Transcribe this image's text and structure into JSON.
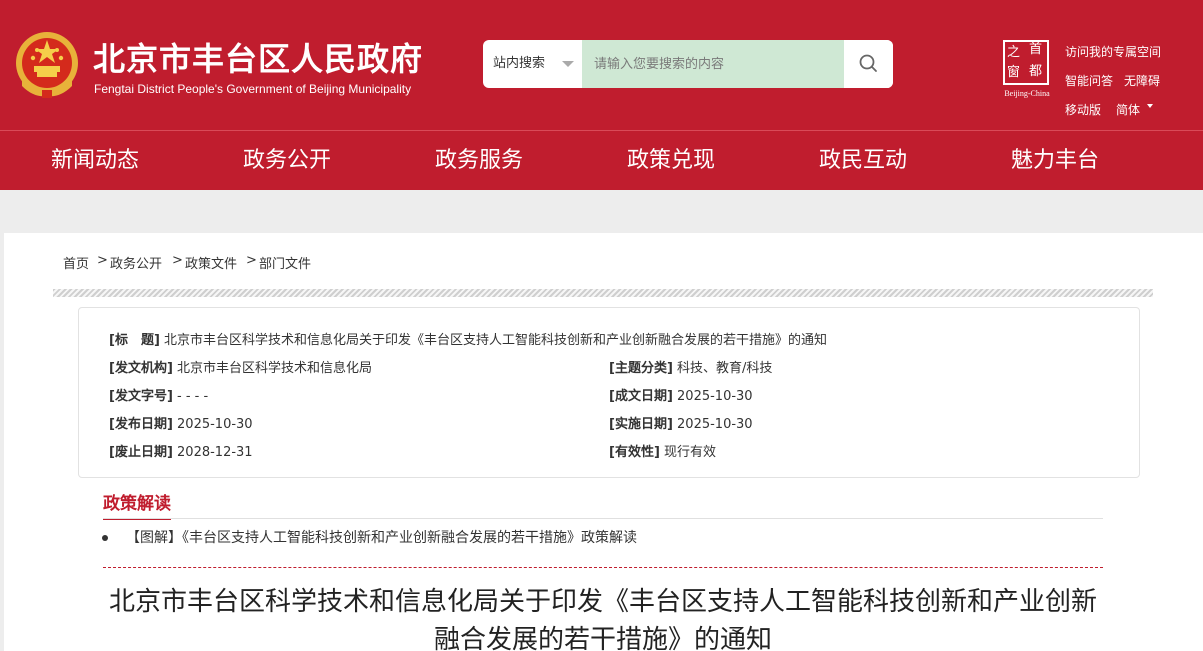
{
  "header": {
    "title": "北京市丰台区人民政府",
    "subtitle": "Fengtai District People's Government of Beijing Municipality",
    "search": {
      "scope": "站内搜索",
      "placeholder": "请输入您要搜索的内容"
    },
    "capital_logo": {
      "chars": [
        "之",
        "首",
        "窗",
        "都"
      ],
      "caption": "Beijing-China"
    },
    "links": {
      "personal_space": "访问我的专属空间",
      "smart_qa": "智能问答",
      "accessible": "无障碍",
      "mobile": "移动版",
      "language": "简体"
    }
  },
  "nav": [
    "新闻动态",
    "政务公开",
    "政务服务",
    "政策兑现",
    "政民互动",
    "魅力丰台"
  ],
  "breadcrumb": {
    "items": [
      "首页",
      "政务公开",
      "政策文件",
      "部门文件"
    ],
    "separator": ">"
  },
  "meta": {
    "title_label": "[标　题]",
    "title_value": "北京市丰台区科学技术和信息化局关于印发《丰台区支持人工智能科技创新和产业创新融合发展的若干措施》的通知",
    "issuer_label": "[发文机构]",
    "issuer_value": "北京市丰台区科学技术和信息化局",
    "topic_label": "[主题分类]",
    "topic_value": "科技、教育/科技",
    "docno_label": "[发文字号]",
    "docno_value": "- - - -",
    "created_label": "[成文日期]",
    "created_value": "2025-10-30",
    "published_label": "[发布日期]",
    "published_value": "2025-10-30",
    "effective_label": "[实施日期]",
    "effective_value": "2025-10-30",
    "expire_label": "[废止日期]",
    "expire_value": "2028-12-31",
    "validity_label": "[有效性]",
    "validity_value": "现行有效"
  },
  "interpretation": {
    "heading": "政策解读",
    "link": "【图解】《丰台区支持人工智能科技创新和产业创新融合发展的若干措施》政策解读"
  },
  "document": {
    "title": "北京市丰台区科学技术和信息化局关于印发《丰台区支持人工智能科技创新和产业创新融合发展的若干措施》的通知"
  },
  "colors": {
    "brand_red": "#c01d2e",
    "search_input_bg": "#cfe8d4"
  }
}
